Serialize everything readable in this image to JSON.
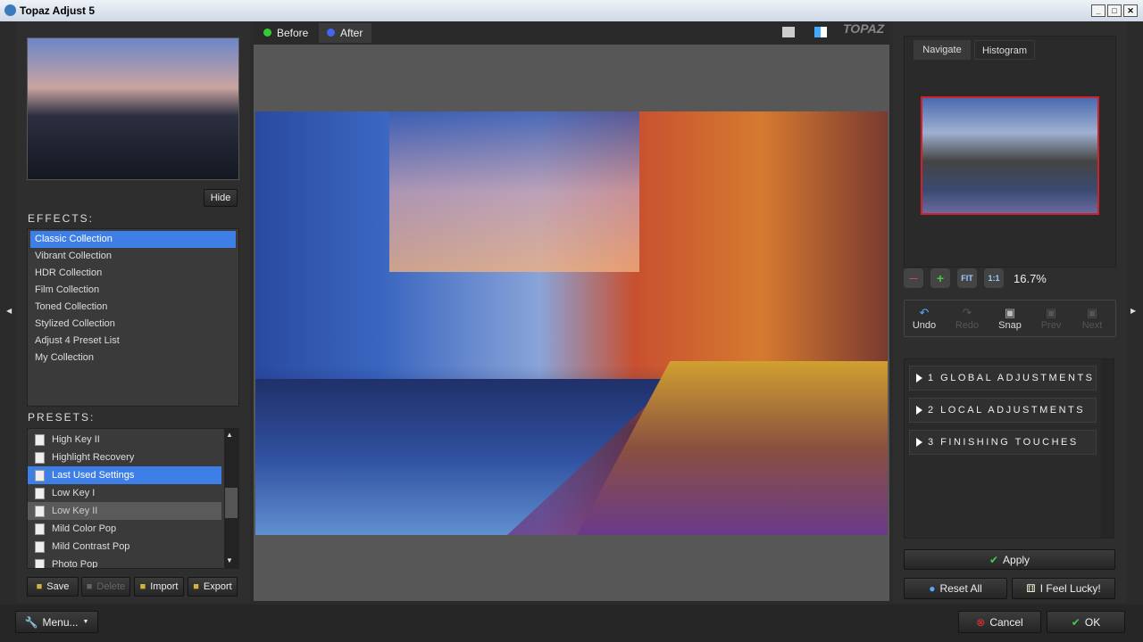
{
  "window": {
    "title": "Topaz Adjust 5"
  },
  "left": {
    "hide_label": "Hide",
    "effects_label": "EFFECTS:",
    "effects": [
      "Classic Collection",
      "Vibrant Collection",
      "HDR Collection",
      "Film Collection",
      "Toned Collection",
      "Stylized Collection",
      "Adjust 4 Preset List",
      "My Collection"
    ],
    "selected_effect": "Classic Collection",
    "presets_label": "PRESETS:",
    "presets": [
      "High Key II",
      "Highlight Recovery",
      "Last Used Settings",
      "Low Key I",
      "Low Key II",
      "Mild Color Pop",
      "Mild Contrast Pop",
      "Photo Pop"
    ],
    "selected_preset": "Last Used Settings",
    "hovered_preset": "Low Key II",
    "buttons": {
      "save": "Save",
      "delete": "Delete",
      "import": "Import",
      "export": "Export"
    }
  },
  "view_tabs": {
    "before": "Before",
    "after": "After",
    "active": "After"
  },
  "navigator": {
    "tabs": [
      "Navigate",
      "Histogram"
    ],
    "active_tab": "Navigate",
    "zoom": "16.7%",
    "zoom_buttons": {
      "fit": "FIT",
      "one": "1:1"
    }
  },
  "history": {
    "undo": "Undo",
    "redo": "Redo",
    "snap": "Snap",
    "prev": "Prev",
    "next": "Next"
  },
  "sections": [
    "1 GLOBAL ADJUSTMENTS",
    "2 LOCAL ADJUSTMENTS",
    "3 FINISHING TOUCHES"
  ],
  "actions": {
    "apply": "Apply",
    "reset_all": "Reset All",
    "lucky": "I Feel Lucky!",
    "cancel": "Cancel",
    "ok": "OK",
    "menu": "Menu..."
  },
  "colors": {
    "selection": "#3d7fe6",
    "nav_frame": "#d0202a"
  }
}
